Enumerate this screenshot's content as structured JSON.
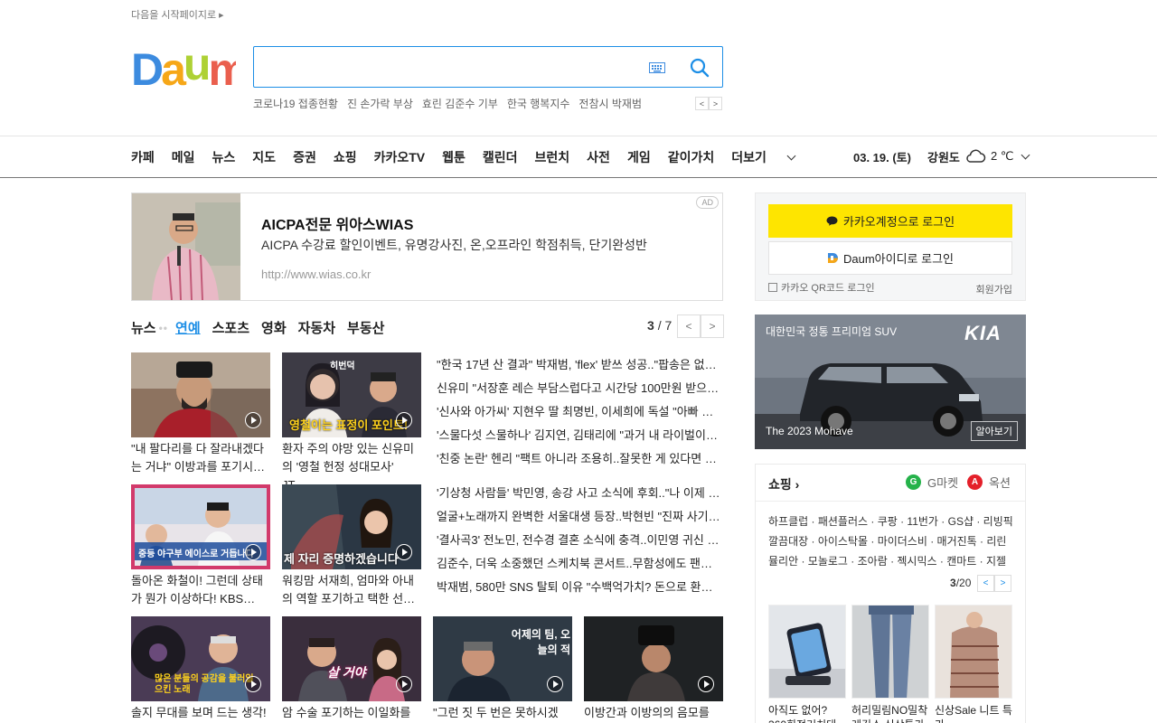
{
  "header": {
    "set_homepage": "다음을 시작페이지로",
    "logo_text": "Daum",
    "search_placeholder": "",
    "trending": [
      "코로나19 접종현황",
      "진 손가락 부상",
      "효린 김준수 기부",
      "한국 행복지수",
      "전참시 박재범"
    ]
  },
  "nav": {
    "items": [
      "카페",
      "메일",
      "뉴스",
      "지도",
      "증권",
      "쇼핑",
      "카카오TV",
      "웹툰",
      "캘린더",
      "브런치",
      "사전",
      "게임",
      "같이가치"
    ],
    "more": "더보기",
    "date": "03. 19. (토)",
    "region": "강원도",
    "temp": "2",
    "temp_unit": "℃"
  },
  "ad": {
    "title": "AICPA전문 위아스WIAS",
    "desc": "AICPA 수강료 할인이벤트, 유명강사진, 온,오프라인 학점취득, 단기완성반",
    "url": "http://www.wias.co.kr",
    "badge": "AD"
  },
  "news": {
    "tabs": [
      "뉴스",
      "연예",
      "스포츠",
      "영화",
      "자동차",
      "부동산"
    ],
    "active_tab": "연예",
    "page_current": "3",
    "page_total": "/ 7",
    "cards_row1": [
      {
        "caption": "\"내 팔다리를 다 잘라내겠다는 거냐\" 이방과를 포기시…",
        "thumb_text": ""
      },
      {
        "caption": "환자 주의 야망 있는 신유미의 '영철 헌정 성대모사' JT…",
        "thumb_text": "영철이는 표정이 포인트!",
        "badge": "히번덕"
      }
    ],
    "cards_row2": [
      {
        "caption": "돌아온 화철이! 그런데 상태가 뭔가 이상하다! KBS…",
        "thumb_text": "중등 야구부 에이스로 거듭나다"
      },
      {
        "caption": "워킹맘 서재희, 엄마와 아내의 역할 포기하고 택한 선…",
        "thumb_text": "제 자리 증명하겠습니다"
      }
    ],
    "cards_row3": [
      {
        "caption": "솔지 무대를 보며 드는 생각!",
        "thumb_text": "많은 분들의 공감을 불러일으킨 노래"
      },
      {
        "caption": "암 수술 포기하는 이일화를",
        "thumb_text": "살 거야"
      },
      {
        "caption": "\"그런 짓 두 번은 못하시겠",
        "thumb_text": "어제의 팀, 오늘의 적"
      },
      {
        "caption": "이방간과 이방의의 음모를",
        "thumb_text": ""
      }
    ],
    "list1": [
      "\"한국 17년 산 결과\" 박재범, 'flex' 받쓰 성공..\"팝송은 없나\" (…",
      "신유미 \"서장훈 레슨 부담스럽다고 시간당 100만원 받으라…",
      "'신사와 아가씨' 지현우 딸 최명빈, 이세희에 독설 \"아빠 여…",
      "'스물다섯 스물하나' 김지연, 김태리에 \"과거 내 라이벌이었…",
      "'친중 논란' 헨리 \"팩트 아니라 조용히..잘못한 게 있다면 죄…"
    ],
    "list2": [
      "'기상청 사람들' 박민영, 송강 사고 소식에 후회..\"나 이제 어…",
      "얼굴+노래까지 완벽한 서울대생 등장..박현빈 \"진짜 사기…",
      "'결사곡3' 전노민, 전수경 결혼 소식에 충격..이민영 귀신 등장",
      "김준수, 더욱 소중했던 스케치북 콘서트..무함성에도 팬들…",
      "박재범, 580만 SNS 탈퇴 이유 \"수백억가치? 돈으로 환불 …"
    ]
  },
  "login": {
    "kakao": "카카오계정으로 로그인",
    "daum": "Daum아이디로 로그인",
    "qr": "카카오 QR코드 로그인",
    "signup": "회원가입"
  },
  "car_ad": {
    "headline": "대한민국 정통 프리미엄 SUV",
    "brand": "KIA",
    "model": "The 2023 Mohave",
    "button": "알아보기"
  },
  "shopping": {
    "title": "쇼핑",
    "gmarket": "G마켓",
    "auction": "옥션",
    "links": [
      "하프클럽 · 패션플러스 · 쿠팡 · 11번가 · GS샵 · 리빙픽",
      "깔끔대장 · 아이스탁몰 · 마이더스비 · 매거진톡 · 리린",
      "뮬리안 · 모놀로그 · 조아람 · 젝시믹스 · 캔마트 · 지젤"
    ],
    "page_current": "3",
    "page_total": "/20",
    "products": [
      {
        "caption": "아직도 없어? 360회전거치대"
      },
      {
        "caption": "허리밀림NO밀착 레깅스 신상특가"
      },
      {
        "caption": "신상Sale 니트 특가"
      }
    ]
  },
  "colors": {
    "accent": "#1c8ee6",
    "kakao_yellow": "#fee500",
    "gmarket_green": "#25b24a",
    "auction_red": "#e4202a"
  }
}
